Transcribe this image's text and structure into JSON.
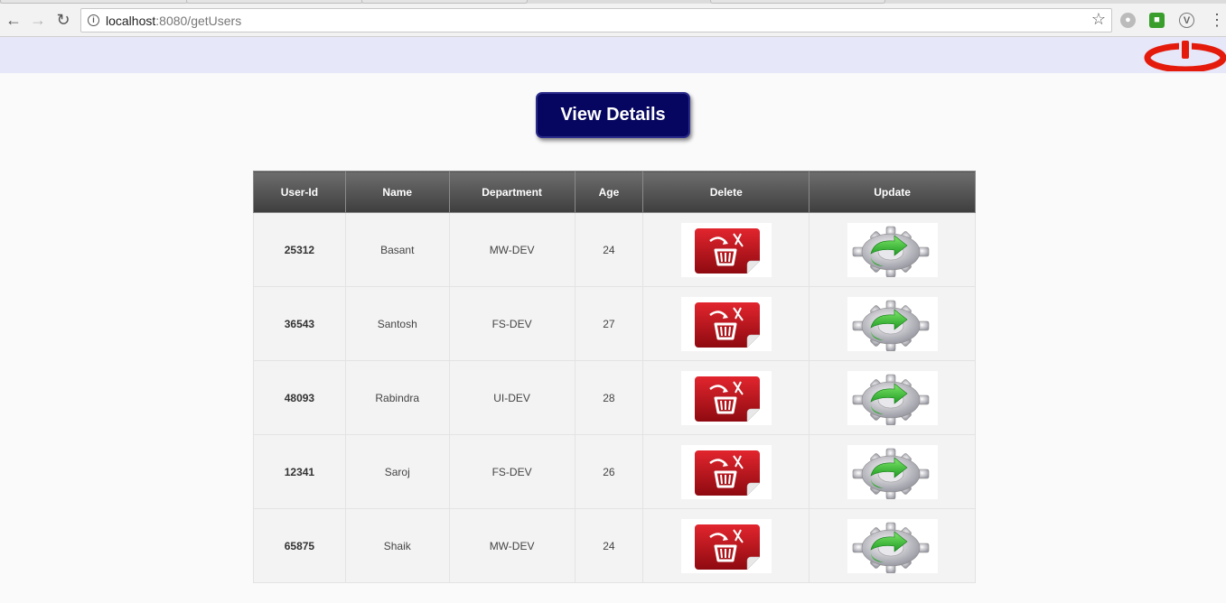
{
  "browser": {
    "url_host": "localhost",
    "url_rest": ":8080/getUsers"
  },
  "icons": {
    "back": "arrow-left-icon",
    "forward": "arrow-right-icon",
    "reload": "reload-icon",
    "info": "info-icon",
    "bookmark": "star-icon",
    "power": "power-icon",
    "delete": "trash-icon",
    "update": "gear-refresh-icon"
  },
  "colors": {
    "header_bg": "#e6e7f8",
    "button_bg": "#060660",
    "table_header": "#4a4a4a",
    "delete_red": "#c0101a",
    "update_green": "#2fb82f"
  },
  "main": {
    "view_details_label": "View Details"
  },
  "table": {
    "headers": {
      "id": "User-Id",
      "name": "Name",
      "department": "Department",
      "age": "Age",
      "delete": "Delete",
      "update": "Update"
    },
    "rows": [
      {
        "id": "25312",
        "name": "Basant",
        "department": "MW-DEV",
        "age": "24"
      },
      {
        "id": "36543",
        "name": "Santosh",
        "department": "FS-DEV",
        "age": "27"
      },
      {
        "id": "48093",
        "name": "Rabindra",
        "department": "UI-DEV",
        "age": "28"
      },
      {
        "id": "12341",
        "name": "Saroj",
        "department": "FS-DEV",
        "age": "26"
      },
      {
        "id": "65875",
        "name": "Shaik",
        "department": "MW-DEV",
        "age": "24"
      }
    ]
  }
}
